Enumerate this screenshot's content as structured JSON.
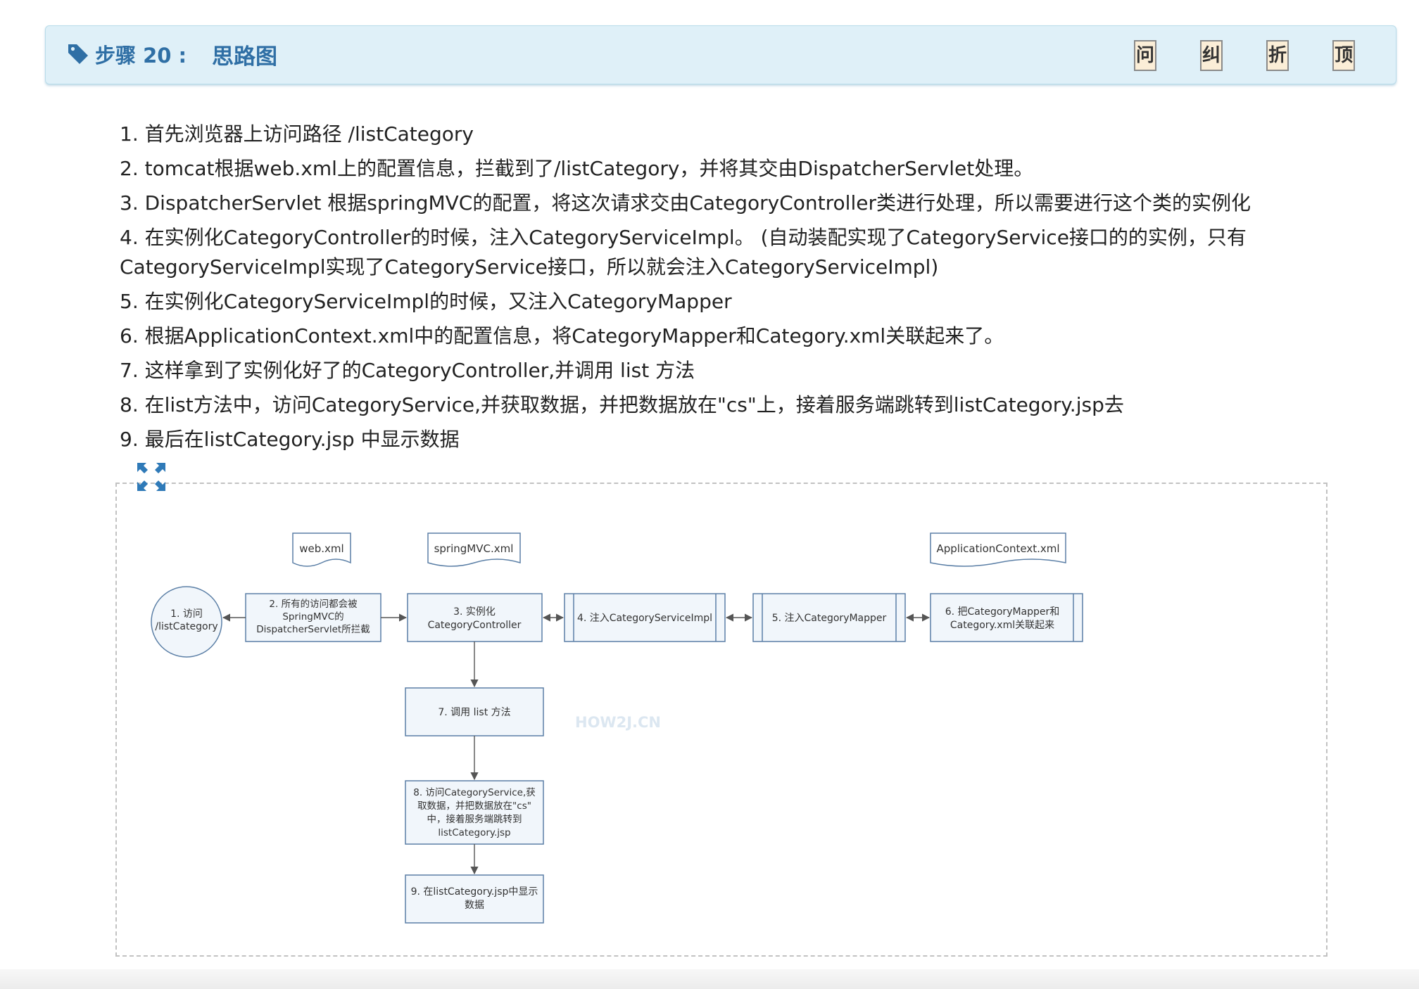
{
  "header": {
    "step_label": "步骤 20 :",
    "title": "思路图",
    "buttons": [
      "问",
      "纠",
      "折",
      "顶"
    ]
  },
  "steps": [
    "1. 首先浏览器上访问路径 /listCategory",
    "2. tomcat根据web.xml上的配置信息，拦截到了/listCategory，并将其交由DispatcherServlet处理。",
    "3. DispatcherServlet 根据springMVC的配置，将这次请求交由CategoryController类进行处理，所以需要进行这个类的实例化",
    "4. 在实例化CategoryController的时候，注入CategoryServiceImpl。 (自动装配实现了CategoryService接口的的实例，只有CategoryServiceImpl实现了CategoryService接口，所以就会注入CategoryServiceImpl)",
    "5. 在实例化CategoryServiceImpl的时候，又注入CategoryMapper",
    "6. 根据ApplicationContext.xml中的配置信息，将CategoryMapper和Category.xml关联起来了。",
    "7. 这样拿到了实例化好了的CategoryController,并调用 list 方法",
    "8. 在list方法中，访问CategoryService,并获取数据，并把数据放在\"cs\"上，接着服务端跳转到listCategory.jsp去",
    "9. 最后在listCategory.jsp 中显示数据"
  ],
  "diagram": {
    "docs": [
      "web.xml",
      "springMVC.xml",
      "ApplicationContext.xml"
    ],
    "node1": [
      "1.  访问",
      "/listCategory"
    ],
    "node2": [
      "2.  所有的访问都会被",
      "SpringMVC的",
      "DispatcherServlet所拦截"
    ],
    "node3": [
      "3.  实例化",
      "CategoryController"
    ],
    "node4": "4.  注入CategoryServiceImpl",
    "node5": "5.  注入CategoryMapper",
    "node6": [
      "6. 把CategoryMapper和",
      "Category.xml关联起来"
    ],
    "node7": "7.  调用  list 方法",
    "node8": [
      "8.  访问CategoryService,获",
      "取数据，并把数据放在\"cs\"",
      "中，接着服务端跳转到",
      "listCategory.jsp"
    ],
    "node9": [
      "9.  在listCategory.jsp中显示",
      "数据"
    ],
    "watermark": "HOW2J.CN"
  },
  "colors": {
    "header_bg": "#dff0f8",
    "header_text": "#2f6fa5",
    "node_fill": "#f1f6fb",
    "node_stroke": "#5b7fa6",
    "button_bg": "#fbeed7"
  },
  "icons": [
    "tag-icon",
    "expand-icon"
  ]
}
